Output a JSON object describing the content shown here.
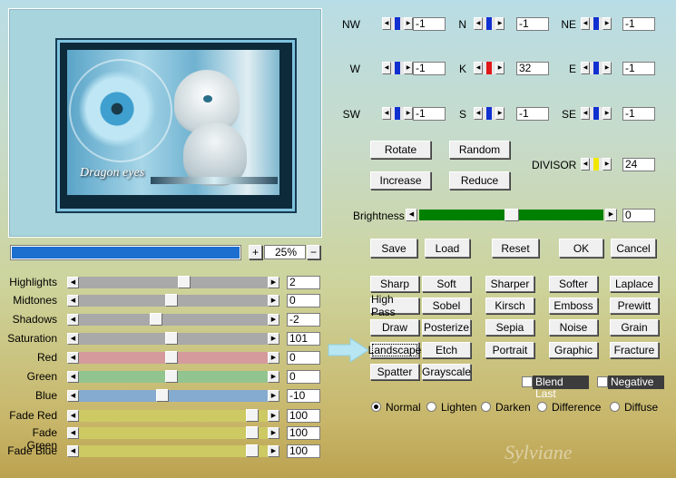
{
  "preview": {
    "caption": "Dragon eyes"
  },
  "zoom": {
    "value": "25%",
    "plus": "+",
    "minus": "−",
    "progress": 1.0
  },
  "sliders": [
    {
      "label": "Highlights",
      "value": "2",
      "pos": 0.56,
      "color": "#a9a9a9"
    },
    {
      "label": "Midtones",
      "value": "0",
      "pos": 0.49,
      "color": "#a9a9a9"
    },
    {
      "label": "Shadows",
      "value": "-2",
      "pos": 0.4,
      "color": "#a9a9a9"
    },
    {
      "label": "Saturation",
      "value": "101",
      "pos": 0.49,
      "color": "#a9a9a9"
    },
    {
      "label": "Red",
      "value": "0",
      "pos": 0.49,
      "color": "#d49a9c"
    },
    {
      "label": "Green",
      "value": "0",
      "pos": 0.49,
      "color": "#92c48f"
    },
    {
      "label": "Blue",
      "value": "-10",
      "pos": 0.44,
      "color": "#86abd0"
    },
    {
      "label": "Fade Red",
      "value": "100",
      "pos": 0.95,
      "color": "#cdc963"
    },
    {
      "label": "Fade Green",
      "value": "100",
      "pos": 0.95,
      "color": "#cdc963"
    },
    {
      "label": "Fade Blue",
      "value": "100",
      "pos": 0.95,
      "color": "#cdc963"
    }
  ],
  "matrix": [
    {
      "label": "NW",
      "value": "-1",
      "color": "#1030d0"
    },
    {
      "label": "N",
      "value": "-1",
      "color": "#1030d0"
    },
    {
      "label": "NE",
      "value": "-1",
      "color": "#1030d0"
    },
    {
      "label": "W",
      "value": "-1",
      "color": "#1030d0"
    },
    {
      "label": "K",
      "value": "32",
      "color": "#e01818"
    },
    {
      "label": "E",
      "value": "-1",
      "color": "#1030d0"
    },
    {
      "label": "SW",
      "value": "-1",
      "color": "#1030d0"
    },
    {
      "label": "S",
      "value": "-1",
      "color": "#1030d0"
    },
    {
      "label": "SE",
      "value": "-1",
      "color": "#1030d0"
    }
  ],
  "matrix_buttons": {
    "rotate": "Rotate",
    "random": "Random",
    "increase": "Increase",
    "reduce": "Reduce"
  },
  "divisor": {
    "label": "DIVISOR",
    "value": "24",
    "color": "#f0e800"
  },
  "brightness": {
    "label": "Brightness",
    "value": "0",
    "pos": 0.5,
    "color": "#008000"
  },
  "actions": {
    "save": "Save",
    "load": "Load",
    "reset": "Reset",
    "ok": "OK",
    "cancel": "Cancel"
  },
  "presets": [
    [
      "Sharp",
      "Soft",
      "Sharper",
      "Softer",
      "Laplace"
    ],
    [
      "High Pass",
      "Sobel",
      "Kirsch",
      "Emboss",
      "Prewitt"
    ],
    [
      "Draw",
      "Posterize",
      "Sepia",
      "Noise",
      "Grain"
    ],
    [
      "Landscape",
      "Etch",
      "Portrait",
      "Graphic",
      "Fracture"
    ],
    [
      "Spatter",
      "Grayscale"
    ]
  ],
  "options": {
    "blend_last": "Blend Last",
    "negative": "Negative"
  },
  "blend_modes": {
    "selected": "Normal",
    "items": [
      "Normal",
      "Lighten",
      "Darken",
      "Difference",
      "Diffuse"
    ]
  },
  "watermark": "Sylviane",
  "colors": {
    "arrow_pointer": "#b8e6f2"
  }
}
